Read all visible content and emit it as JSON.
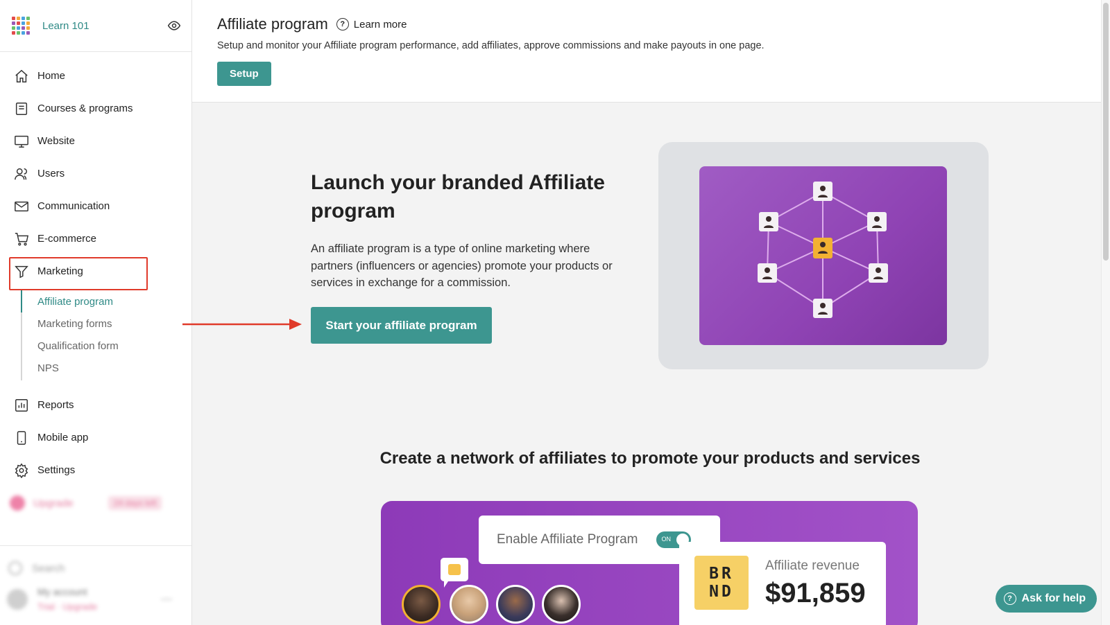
{
  "sidebar": {
    "brand_name": "Learn 101",
    "logo_colors": [
      "#e24b4b",
      "#f4a93c",
      "#4aa3df",
      "#6ac16b",
      "#9b59b6",
      "#e24b4b",
      "#4aa3df",
      "#f4a93c",
      "#6ac16b",
      "#4aa3df",
      "#9b59b6",
      "#f4a93c",
      "#e24b4b",
      "#6ac16b",
      "#4aa3df",
      "#9b59b6"
    ],
    "items": [
      {
        "label": "Home",
        "icon": "home-icon"
      },
      {
        "label": "Courses & programs",
        "icon": "book-icon"
      },
      {
        "label": "Website",
        "icon": "monitor-icon"
      },
      {
        "label": "Users",
        "icon": "users-icon"
      },
      {
        "label": "Communication",
        "icon": "mail-icon"
      },
      {
        "label": "E-commerce",
        "icon": "cart-icon"
      },
      {
        "label": "Marketing",
        "icon": "funnel-icon"
      }
    ],
    "marketing_sub": [
      {
        "label": "Affiliate program",
        "active": true
      },
      {
        "label": "Marketing forms"
      },
      {
        "label": "Qualification form"
      },
      {
        "label": "NPS"
      }
    ],
    "items2": [
      {
        "label": "Reports",
        "icon": "chart-icon"
      },
      {
        "label": "Mobile app",
        "icon": "phone-icon"
      },
      {
        "label": "Settings",
        "icon": "gear-icon"
      }
    ],
    "upgrade_label": "Upgrade",
    "upgrade_badge": "24 days left",
    "search_label": "Search",
    "account_name": "My account",
    "account_plan": "Trial · Upgrade"
  },
  "header": {
    "title": "Affiliate program",
    "learn_more": "Learn more",
    "subtitle": "Setup and monitor your Affiliate program performance, add affiliates, approve commissions and make payouts in one page.",
    "setup_button": "Setup"
  },
  "hero": {
    "title": "Launch your branded Affiliate program",
    "description": "An affiliate program is a type of online marketing where partners (influencers or agencies) promote your products or services in exchange for a commission.",
    "cta": "Start your affiliate program"
  },
  "network_section": {
    "title": "Create a network of affiliates to promote your products and services",
    "enable_label": "Enable Affiliate Program",
    "toggle_state": "ON",
    "brand_logo": "BR ND",
    "revenue_label": "Affiliate revenue",
    "revenue_value": "$91,859"
  },
  "help_button": "Ask for help",
  "colors": {
    "accent": "#3d9690",
    "brand_text": "#2f8a86",
    "highlight_box": "#e03a2a",
    "banner_purple": "#9747be"
  }
}
